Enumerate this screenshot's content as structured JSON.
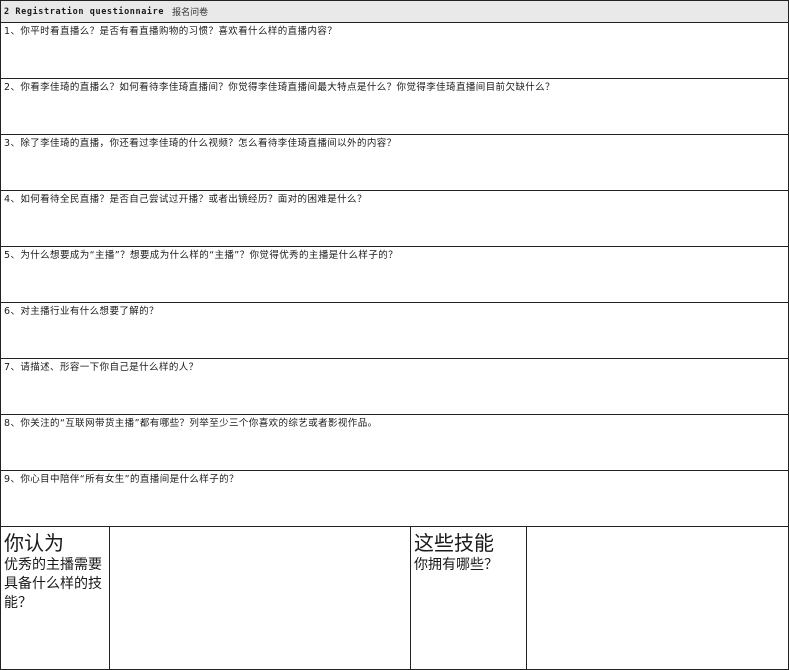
{
  "header": {
    "title_en": "2 Registration questionnaire",
    "title_zh": "报名问卷"
  },
  "questions": [
    "1、你平时看直播么？是否有看直播购物的习惯？喜欢看什么样的直播内容？",
    "2、你看李佳琦的直播么？如何看待李佳琦直播间？你觉得李佳琦直播间最大特点是什么？你觉得李佳琦直播间目前欠缺什么？",
    "3、除了李佳琦的直播，你还看过李佳琦的什么视频？怎么看待李佳琦直播间以外的内容？",
    "4、如何看待全民直播？是否自己尝试过开播？或者出镜经历？面对的困难是什么？",
    "5、为什么想要成为“主播”？想要成为什么样的“主播”？你觉得优秀的主播是什么样子的？",
    "6、对主播行业有什么想要了解的？",
    "7、请描述、形容一下你自己是什么样的人？",
    "8、你关注的“互联网带货主播”都有哪些？列举至少三个你喜欢的综艺或者影视作品。",
    "9、你心目中陪伴“所有女生”的直播间是什么样子的？"
  ],
  "skills_prompt": {
    "heading": "你认为",
    "text": "优秀的主播需要具备什么样的技能？"
  },
  "own_skills_prompt": {
    "heading": "这些技能",
    "text": "你拥有哪些？"
  }
}
